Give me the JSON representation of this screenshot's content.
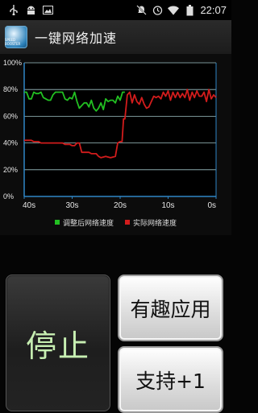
{
  "status_bar": {
    "time": "22:07",
    "left_icons": [
      "usb-icon",
      "android-debug-icon",
      "image-icon"
    ],
    "right_icons": [
      "mute-icon",
      "alarm-icon",
      "wifi-icon",
      "battery-icon"
    ]
  },
  "app": {
    "title": "一键网络加速",
    "logo_text": "SPEED BOOSTER"
  },
  "chart_data": {
    "type": "line",
    "y_ticks": [
      "100%",
      "80%",
      "60%",
      "40%",
      "20%",
      "0%"
    ],
    "x_ticks": [
      "40s",
      "30s",
      "20s",
      "10s",
      "0s"
    ],
    "ylim": [
      0,
      100
    ],
    "xlim": [
      40,
      0
    ],
    "grid": true,
    "legend_position": "bottom",
    "colors": {
      "adjusted": "#22c022",
      "actual": "#d21c1c",
      "grid": "#9fc3c6",
      "axis": "#2f86c6"
    },
    "series": [
      {
        "name": "调整后网络速度",
        "x": [
          40,
          39.5,
          39,
          38.5,
          38,
          37.5,
          37,
          36.5,
          36,
          35.5,
          35,
          34.5,
          34,
          33.5,
          33,
          32.5,
          32,
          31.5,
          31,
          30.5,
          30,
          29.5,
          29,
          28.5,
          28,
          27.5,
          27,
          26.5,
          26,
          25.5,
          25,
          24.5,
          24,
          23.5,
          23,
          22.5,
          22,
          21.5,
          21,
          20.5,
          20,
          19.5,
          19
        ],
        "values": [
          78,
          78,
          73,
          73,
          78,
          77,
          77,
          78,
          74,
          73,
          72,
          72,
          76,
          78,
          78,
          78,
          78,
          73,
          72,
          74,
          73,
          78,
          71,
          66,
          68,
          70,
          70,
          67,
          72,
          66,
          64,
          66,
          70,
          65,
          73,
          71,
          72,
          72,
          70,
          75,
          72,
          78,
          78
        ]
      },
      {
        "name": "实际网络速度",
        "x": [
          40,
          38.5,
          38,
          37,
          36.5,
          35,
          34,
          33,
          32,
          31.5,
          31,
          30.5,
          30,
          29.5,
          29,
          28.5,
          28,
          27.5,
          27,
          26.5,
          26,
          25,
          24.5,
          24,
          23,
          22,
          21,
          20.5,
          20,
          19.6,
          19.3,
          19,
          18.5,
          18,
          17.5,
          17,
          16.5,
          16,
          15.5,
          15,
          14.5,
          14,
          13.5,
          13,
          12.5,
          12,
          11.5,
          11,
          10.5,
          10,
          9.5,
          9,
          8.5,
          8,
          7.5,
          7,
          6.5,
          6,
          5.5,
          5,
          4.5,
          4,
          3.5,
          3,
          2.5,
          2,
          1.5,
          1,
          0.5,
          0
        ],
        "values": [
          42,
          42,
          41,
          41,
          40,
          40,
          40,
          40,
          40,
          39,
          39,
          39,
          38,
          38,
          40,
          40,
          33,
          33,
          33,
          33,
          32,
          32,
          30,
          29,
          30,
          29,
          30,
          40,
          41,
          41,
          58,
          58,
          76,
          78,
          70,
          76,
          71,
          69,
          74,
          69,
          66,
          67,
          71,
          75,
          74,
          75,
          73,
          78,
          75,
          79,
          72,
          78,
          74,
          78,
          74,
          77,
          74,
          80,
          72,
          78,
          74,
          79,
          75,
          75,
          78,
          71,
          80,
          73,
          76,
          74
        ]
      }
    ]
  },
  "legend": {
    "items": [
      {
        "label": "调整后网络速度",
        "color": "#22c022"
      },
      {
        "label": "实际网络速度",
        "color": "#d21c1c"
      }
    ]
  },
  "buttons": {
    "stop": "停止",
    "fun_apps": "有趣应用",
    "support": "支持+1"
  }
}
